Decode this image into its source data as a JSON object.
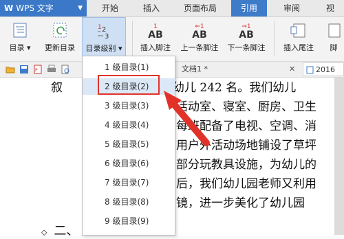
{
  "app": {
    "name": "WPS 文字"
  },
  "tabs": [
    "开始",
    "插入",
    "页面布局",
    "引用",
    "审阅",
    "视"
  ],
  "active_tab": "引用",
  "ribbon": {
    "buttons": [
      {
        "label": "目录 ▾"
      },
      {
        "label": "更新目录"
      },
      {
        "label": "目录级别 ▾"
      },
      {
        "label": "插入脚注"
      },
      {
        "label": "上一条脚注"
      },
      {
        "label": "下一条脚注"
      },
      {
        "label": "插入尾注"
      },
      {
        "label": "脚"
      }
    ]
  },
  "doc_tabs": {
    "current": "文档1 *",
    "other": "2016"
  },
  "dropdown": {
    "items": [
      "1 级目录(1)",
      "2 级目录(2)",
      "3 级目录(3)",
      "4 级目录(4)",
      "5 级目录(5)",
      "6 级目录(6)",
      "7 级目录(7)",
      "8 级目录(8)",
      "9 级目录(9)"
    ],
    "highlighted": "2 级目录(2)"
  },
  "document": {
    "lines": [
      "叙",
      "。幼儿 242 名。我们幼儿",
      "活动室、寝室、厨房、卫生",
      "每班配备了电视、空调、消",
      "用户外活动场地铺设了草坪",
      "部分玩教具设施，为幼儿的",
      "后，我们幼儿园老师又利用",
      "镜，进一步美化了幼儿园"
    ],
    "heading": "二、"
  },
  "colors": {
    "accent": "#3e7bc9",
    "highlight_box": "#e1322a"
  }
}
